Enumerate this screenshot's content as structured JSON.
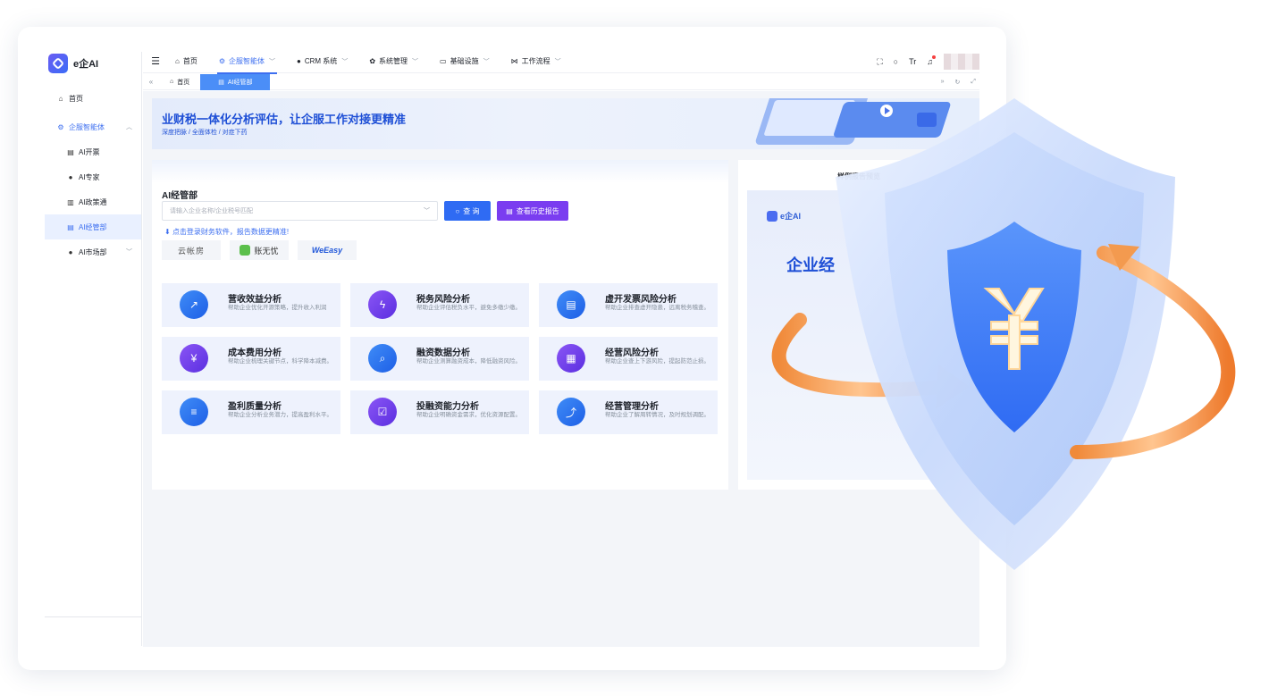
{
  "app": {
    "logo_text": "e企AI"
  },
  "sidebar": {
    "items": [
      {
        "label": "首页",
        "icon": "home-icon"
      },
      {
        "label": "企服智能体",
        "icon": "robot-icon"
      },
      {
        "label": "AI开票",
        "icon": "invoice-icon"
      },
      {
        "label": "AI专家",
        "icon": "user-icon"
      },
      {
        "label": "AI政策通",
        "icon": "bank-icon"
      },
      {
        "label": "AI经管部",
        "icon": "document-icon"
      },
      {
        "label": "AI市场部",
        "icon": "apple-icon"
      }
    ]
  },
  "topbar": {
    "tabs": [
      {
        "label": "首页"
      },
      {
        "label": "企服智能体"
      },
      {
        "label": "CRM 系统"
      },
      {
        "label": "系统管理"
      },
      {
        "label": "基础设施"
      },
      {
        "label": "工作流程"
      }
    ],
    "font_icon_label": "Tr"
  },
  "tabstrip": {
    "tabs": [
      {
        "label": "首页"
      },
      {
        "label": "AI经管部"
      }
    ]
  },
  "banner": {
    "title": "业财税一体化分析评估，让企服工作对接更精准",
    "subtitle": "深度把脉 / 全面体检 / 对症下药"
  },
  "main": {
    "section_title": "AI经管部",
    "search_placeholder": "请输入企业名称/企业税号匹配",
    "query_button": "查 询",
    "history_button": "查看历史报告",
    "login_tip": "点击登录财务软件，报告数据更精准!",
    "vendors": [
      "云帐房",
      "账无忧",
      "WeEasy"
    ],
    "tiles": [
      {
        "title": "营收效益分析",
        "desc": "帮助企业优化开源策略，提升收入利润",
        "color": "blue"
      },
      {
        "title": "税务风险分析",
        "desc": "帮助企业评估税负水平，避免多缴少缴。",
        "color": "purple"
      },
      {
        "title": "虚开发票风险分析",
        "desc": "帮助企业排查虚开隐患，远离税务稽查。",
        "color": "blue"
      },
      {
        "title": "成本费用分析",
        "desc": "帮助企业梳理关键节点，科学降本减费。",
        "color": "purple"
      },
      {
        "title": "融资数据分析",
        "desc": "帮助企业测算融资成本，降低融资风险。",
        "color": "blue"
      },
      {
        "title": "经营风险分析",
        "desc": "帮助企业查上下游风险，提起防范止损。",
        "color": "purple"
      },
      {
        "title": "盈利质量分析",
        "desc": "帮助企业分析业务潜力，提高盈利水平。",
        "color": "blue"
      },
      {
        "title": "投融资能力分析",
        "desc": "帮助企业明确资金需求，优化资源配置。",
        "color": "purple"
      },
      {
        "title": "经营管理分析",
        "desc": "帮助企业了解周转情况，及时规划调配。",
        "color": "blue"
      }
    ]
  },
  "side": {
    "title": "样例报告预览",
    "preview_logo": "e企AI",
    "preview_title": "企业经"
  },
  "colors": {
    "primary": "#2f6bf3",
    "purple": "#7a3df0",
    "active_bg": "#e9f0ff"
  }
}
